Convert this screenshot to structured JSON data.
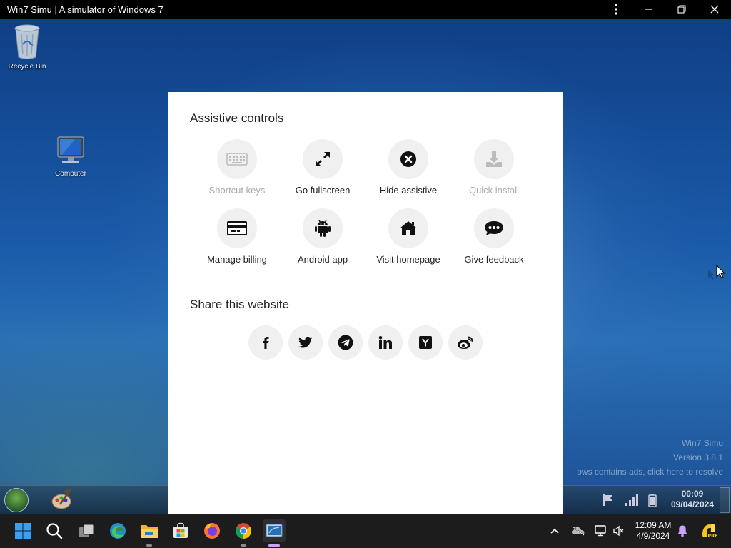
{
  "window": {
    "title": "Win7 Simu | A simulator of Windows 7"
  },
  "desktop": {
    "icons": [
      {
        "label": "Recycle Bin"
      },
      {
        "label": "Computer"
      }
    ],
    "watermark": {
      "line1": "Win7 Simu",
      "line2": "Version 3.8.1",
      "line3": "ows contains ads, click here to resolve"
    }
  },
  "sim_taskbar": {
    "time": "00:09",
    "date": "09/04/2024"
  },
  "modal": {
    "assistive_title": "Assistive controls",
    "controls": [
      {
        "label": "Shortcut keys",
        "icon": "keyboard-icon",
        "enabled": false
      },
      {
        "label": "Go fullscreen",
        "icon": "expand-icon",
        "enabled": true
      },
      {
        "label": "Hide assistive",
        "icon": "close-circle-icon",
        "enabled": true
      },
      {
        "label": "Quick install",
        "icon": "download-icon",
        "enabled": false
      },
      {
        "label": "Manage billing",
        "icon": "credit-card-icon",
        "enabled": true
      },
      {
        "label": "Android app",
        "icon": "android-icon",
        "enabled": true
      },
      {
        "label": "Visit homepage",
        "icon": "home-icon",
        "enabled": true
      },
      {
        "label": "Give feedback",
        "icon": "chat-icon",
        "enabled": true
      }
    ],
    "share_title": "Share this website",
    "share": [
      {
        "network": "facebook",
        "icon": "facebook-icon"
      },
      {
        "network": "twitter",
        "icon": "twitter-icon"
      },
      {
        "network": "telegram",
        "icon": "telegram-icon"
      },
      {
        "network": "linkedin",
        "icon": "linkedin-icon"
      },
      {
        "network": "hacker-news",
        "icon": "ycombinator-icon"
      },
      {
        "network": "weibo",
        "icon": "weibo-icon"
      }
    ]
  },
  "host_taskbar": {
    "time": "12:09 AM",
    "date": "4/9/2024",
    "badge": "PRE"
  }
}
